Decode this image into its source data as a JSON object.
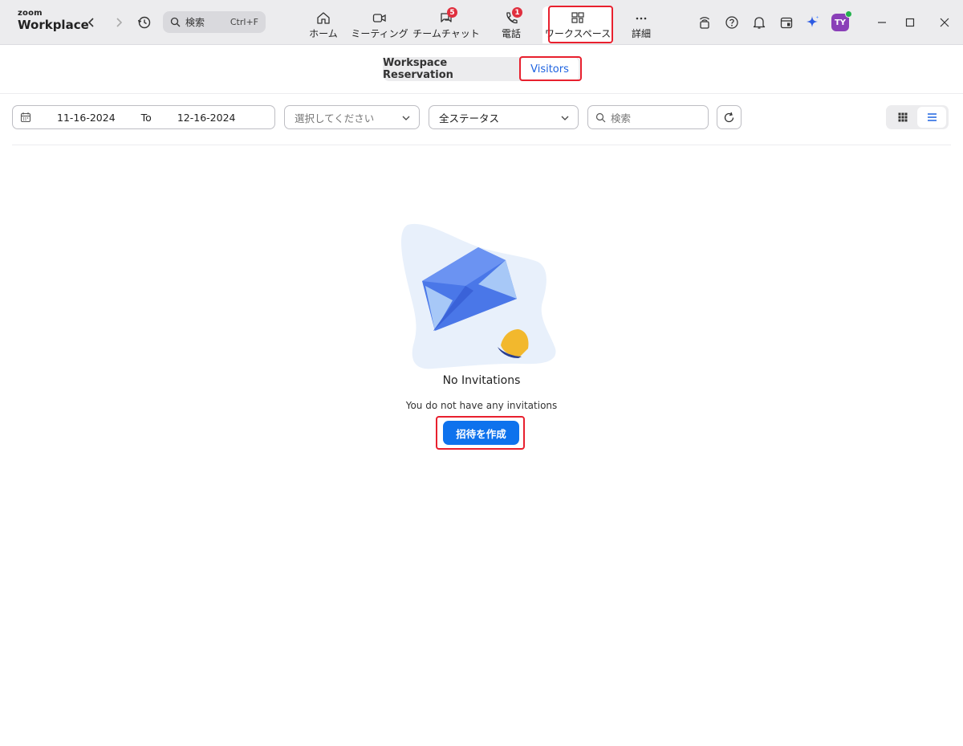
{
  "app": {
    "brand_small": "zoom",
    "brand_large": "Workplace"
  },
  "search": {
    "label": "検索",
    "shortcut": "Ctrl+F"
  },
  "tabs": [
    {
      "label": "ホーム",
      "icon": "home-icon"
    },
    {
      "label": "ミーティング",
      "icon": "video-camera-icon"
    },
    {
      "label": "チームチャット",
      "icon": "chat-icon",
      "badge": "5"
    },
    {
      "label": "電話",
      "icon": "phone-icon",
      "badge": "1"
    },
    {
      "label": "ワークスペース",
      "icon": "workspace-icon",
      "active": true
    },
    {
      "label": "詳細",
      "icon": "more-icon"
    }
  ],
  "user": {
    "initials": "TY",
    "status_color": "#22b14c"
  },
  "segment": {
    "reservation": "Workspace Reservation",
    "visitors": "Visitors"
  },
  "filters": {
    "date_from": "11-16-2024",
    "to_label": "To",
    "date_to": "12-16-2024",
    "select_placeholder": "選択してください",
    "status": "全ステータス",
    "search_placeholder": "検索"
  },
  "empty": {
    "title": "No Invitations",
    "subtitle": "You do not have any invitations",
    "create_button": "招待を作成"
  },
  "colors": {
    "accent": "#0e72ed",
    "highlight": "#e8202e",
    "badge": "#e02f3e"
  }
}
